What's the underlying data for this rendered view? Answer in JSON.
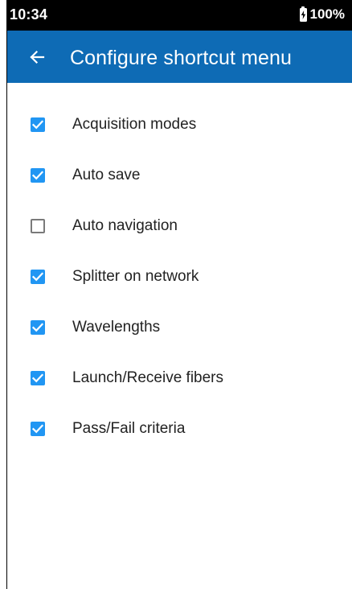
{
  "status_bar": {
    "time": "10:34",
    "battery_percent": "100%",
    "battery_icon": "battery-charging-icon"
  },
  "app_bar": {
    "back_icon": "arrow-back-icon",
    "title": "Configure shortcut menu",
    "color": "#0e6bb5"
  },
  "checkbox_color": "#2196f3",
  "items": [
    {
      "label": "Acquisition modes",
      "checked": true
    },
    {
      "label": "Auto save",
      "checked": true
    },
    {
      "label": "Auto navigation",
      "checked": false
    },
    {
      "label": "Splitter on network",
      "checked": true
    },
    {
      "label": "Wavelengths",
      "checked": true
    },
    {
      "label": "Launch/Receive fibers",
      "checked": true
    },
    {
      "label": "Pass/Fail criteria",
      "checked": true
    }
  ]
}
